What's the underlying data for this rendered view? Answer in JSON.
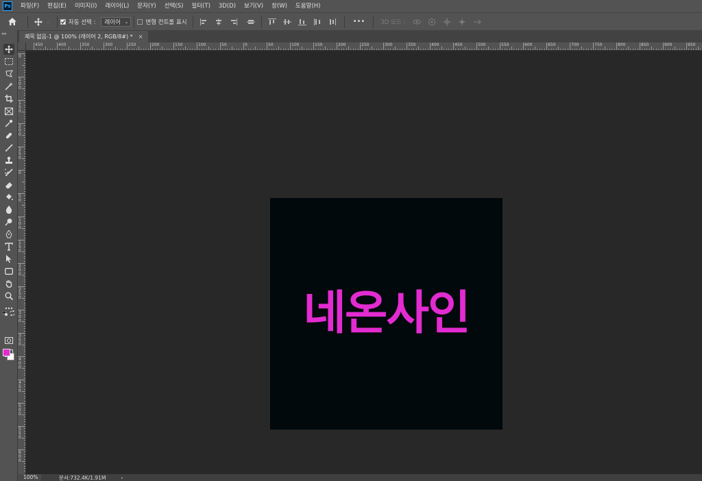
{
  "app": {
    "logo_text": "Ps"
  },
  "menu": [
    "파일(F)",
    "편집(E)",
    "이미지(I)",
    "레이어(L)",
    "문자(Y)",
    "선택(S)",
    "필터(T)",
    "3D(D)",
    "보기(V)",
    "창(W)",
    "도움말(H)"
  ],
  "options": {
    "auto_select_label": "자동 선택 :",
    "auto_select_checked": true,
    "auto_select_target": "레이어",
    "show_transform_label": "변형 컨트롤 표시",
    "show_transform_checked": false,
    "more_label": "•••",
    "mode_3d_label": "3D 모드 :"
  },
  "tab": {
    "title": "제목 없음-1 @ 100% (레이어 2, RGB/8#) *",
    "close": "×"
  },
  "tools": [
    "move-tool",
    "marquee-tool",
    "lasso-tool",
    "magic-wand-tool",
    "crop-tool",
    "frame-tool",
    "eyedropper-tool",
    "healing-brush-tool",
    "brush-tool",
    "clone-stamp-tool",
    "history-brush-tool",
    "eraser-tool",
    "paint-bucket-tool",
    "blur-tool",
    "dodge-tool",
    "pen-tool",
    "type-tool",
    "path-selection-tool",
    "rectangle-tool",
    "hand-tool",
    "zoom-tool",
    "edit-toolbar"
  ],
  "colors": {
    "foreground": "#e22bd0",
    "background": "#ffffff",
    "canvas": "#02090c"
  },
  "ruler_h_labels": [
    "450",
    "400",
    "350",
    "300",
    "250",
    "200",
    "150",
    "100",
    "50",
    "0",
    "50",
    "100",
    "150",
    "200",
    "250",
    "300",
    "350",
    "400",
    "450",
    "500",
    "550",
    "600",
    "650",
    "700",
    "750",
    "800",
    "850",
    "900",
    "950"
  ],
  "ruler_v_labels": [
    "0",
    "1 0 0",
    "1 5 0",
    "2 0 0",
    "2 5 0",
    "0",
    "5 0",
    "1 0 0",
    "1 5 0",
    "2 0 0",
    "2 5 0",
    "3 0 0",
    "3 5 0",
    "4 0 0",
    "4 5 0",
    "5 0 0",
    "5 5 0",
    "6 0 0"
  ],
  "canvas": {
    "text": "네온사인"
  },
  "status": {
    "zoom": "100%",
    "doc_info": "문서:732.4K/1.91M",
    "arrow": "›"
  }
}
